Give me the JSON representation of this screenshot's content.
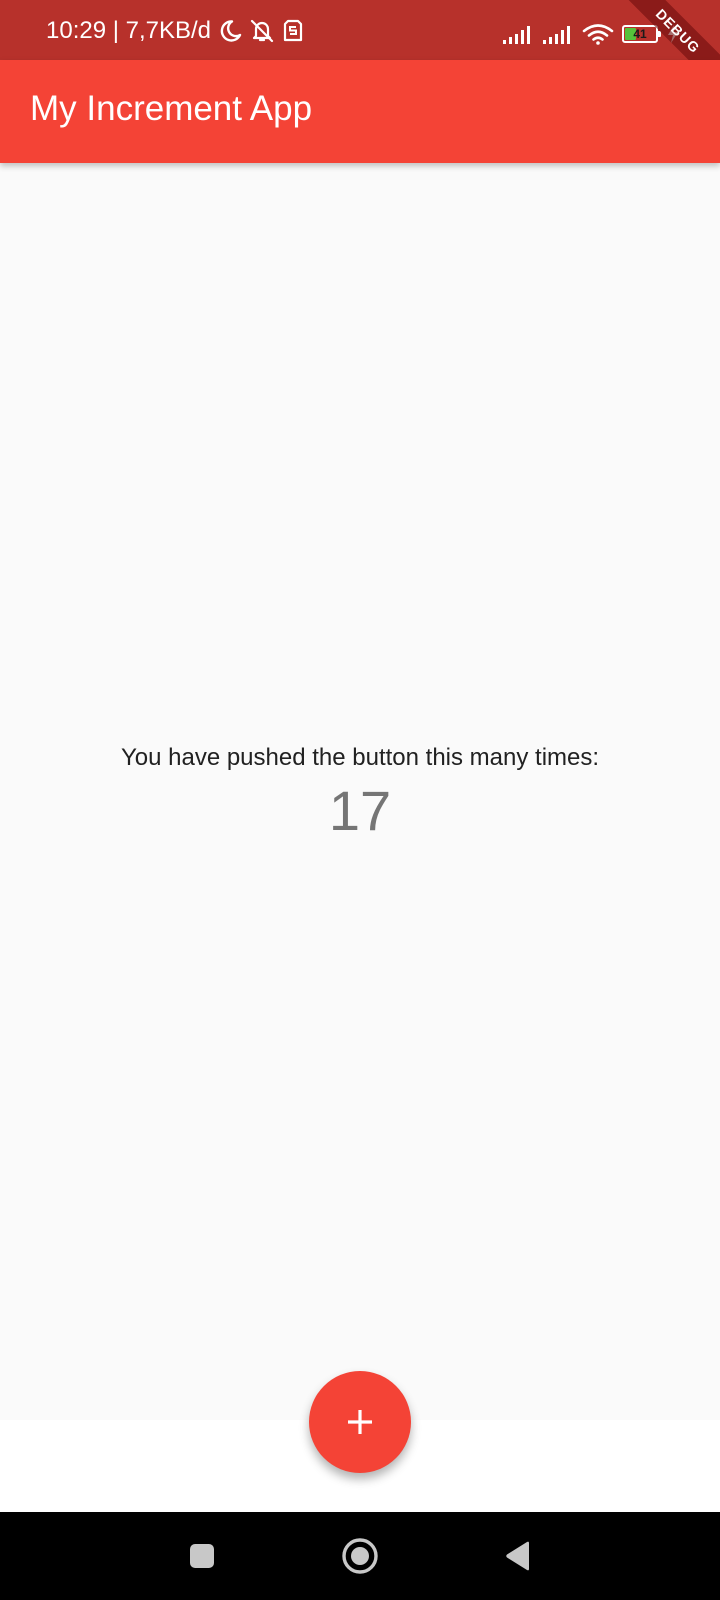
{
  "status_bar": {
    "time_speed": "10:29 | 7,7KB/d",
    "battery_level": "41",
    "battery_fraction": 0.41,
    "background_color": "#b7312b",
    "icons": [
      "moon-icon",
      "bell-off-icon",
      "sim-icon",
      "signal-icon",
      "signal-icon",
      "wifi-icon",
      "battery-icon",
      "charging-icon"
    ]
  },
  "debug_banner": "DEBUG",
  "app_bar": {
    "title": "My Increment App",
    "color": "#f44336"
  },
  "counter": {
    "caption": "You have pushed the button this many times:",
    "value": "17"
  },
  "fab": {
    "icon": "plus-icon",
    "color": "#f44336"
  },
  "nav_bar": {
    "buttons": [
      "recents-icon",
      "home-icon",
      "back-icon"
    ]
  }
}
